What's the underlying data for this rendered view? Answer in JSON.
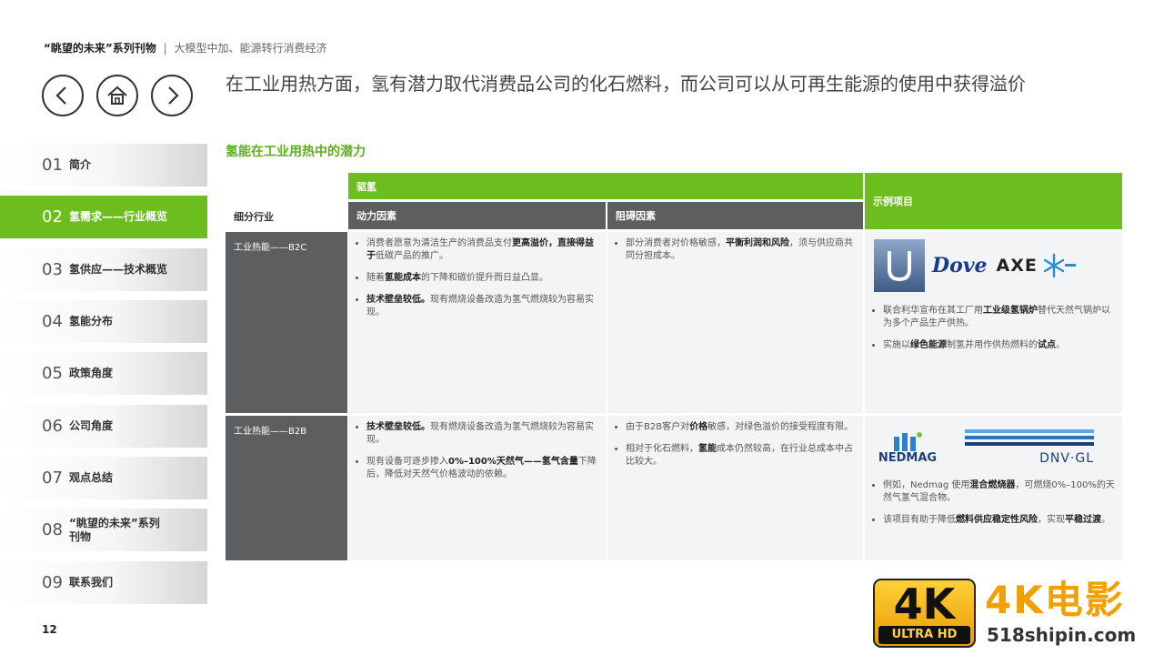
{
  "header": {
    "series_title": "“眺望的未来”系列刊物",
    "separator": "|",
    "subtitle": "大模型中加、能源转行消费经济"
  },
  "nav": {
    "prev_icon": "chevron-left-icon",
    "home_icon": "home-icon",
    "next_icon": "chevron-right-icon"
  },
  "headline": "在工业用热方面，氢有潜力取代消费品公司的化石燃料，而公司可以从可再生能源的使用中获得溢价",
  "sidebar": {
    "items": [
      {
        "num": "01",
        "label": "简介"
      },
      {
        "num": "02",
        "label": "氢需求——行业概览"
      },
      {
        "num": "03",
        "label": "氢供应——技术概览"
      },
      {
        "num": "04",
        "label": "氢能分布"
      },
      {
        "num": "05",
        "label": "政策角度"
      },
      {
        "num": "06",
        "label": "公司角度"
      },
      {
        "num": "07",
        "label": "观点总结"
      },
      {
        "num": "08",
        "label": "“眺望的未来”系列刊物"
      },
      {
        "num": "09",
        "label": "联系我们"
      }
    ],
    "active_index": 1
  },
  "page_number": "12",
  "section_title": "氢能在工业用热中的潜力",
  "table": {
    "group_header": "驱氢",
    "col_industry": "细分行业",
    "col_driver": "动力因素",
    "col_barrier": "阻碍因素",
    "col_case": "示例项目",
    "rows": [
      {
        "label": "工业热能——B2C",
        "drivers": [
          {
            "pre": "消费者愿意为清洁生产的消费品支付",
            "bold": "更高溢价，直接得益于",
            "post": "低碳产品的推广。"
          },
          {
            "pre": "随着",
            "bold": "氢能成本",
            "post": "的下降和碳价提升而日益凸显。"
          },
          {
            "pre": "",
            "bold": "技术壁垒较低。",
            "post": "现有燃烧设备改造为氢气燃烧较为容易实现。"
          }
        ],
        "barriers": [
          {
            "pre": "部分消费者对价格敏感，",
            "bold": "平衡利润和风险",
            "post": "，须与供应商共同分担成本。"
          }
        ],
        "case_logos": [
          "Dove",
          "AXE"
        ],
        "cases": [
          {
            "pre": "联合利华宣布在其工厂用",
            "bold": "工业级氢锅炉",
            "post": "替代天然气锅炉以为多个产品生产供热。"
          },
          {
            "pre": "实施以",
            "bold": "绿色能源",
            "post": "制氢并用作供热燃料的",
            "bold2": "试点",
            "post2": "。"
          }
        ]
      },
      {
        "label": "工业热能——B2B",
        "drivers": [
          {
            "pre": "",
            "bold": "技术壁垒较低。",
            "post": "现有燃烧设备改造为氢气燃烧较为容易实现。"
          },
          {
            "pre": "现有设备可逐步掺入",
            "bold": "0%–100%天然气——氢气",
            "post": "",
            "bold2": "含量",
            "post2": "下降后，降低对天然气价格波动的依赖。"
          }
        ],
        "barriers": [
          {
            "pre": "由于B2B客户对",
            "bold": "价格",
            "post": "敏感，对绿色溢价的接受程度有限。"
          },
          {
            "pre": "相对于化石燃料，",
            "bold": "氢能",
            "post": "成本仍然较高，在行业总成本中占比较大。"
          }
        ],
        "case_logos": [
          "NEDMAG",
          "DNV·GL"
        ],
        "cases": [
          {
            "pre": "例如，Nedmag 使用",
            "bold": "混合燃烧器",
            "post": "，可燃烧0%–100%的天然气氢气混合物。"
          },
          {
            "pre": "该项目有助于降低",
            "bold": "燃料供应稳定性风险",
            "post": "，实现",
            "bold2": "平稳过渡",
            "post2": "。"
          }
        ]
      }
    ]
  },
  "watermark": {
    "badge_big": "4K",
    "badge_small": "ULTRA HD",
    "title": "4K电影",
    "url": "518shipin.com"
  },
  "colors": {
    "accent_green": "#6cbe1e",
    "header_gray": "#5c5e60",
    "cell_bg": "#f3f4f5",
    "watermark_orange": "#f2a000"
  }
}
